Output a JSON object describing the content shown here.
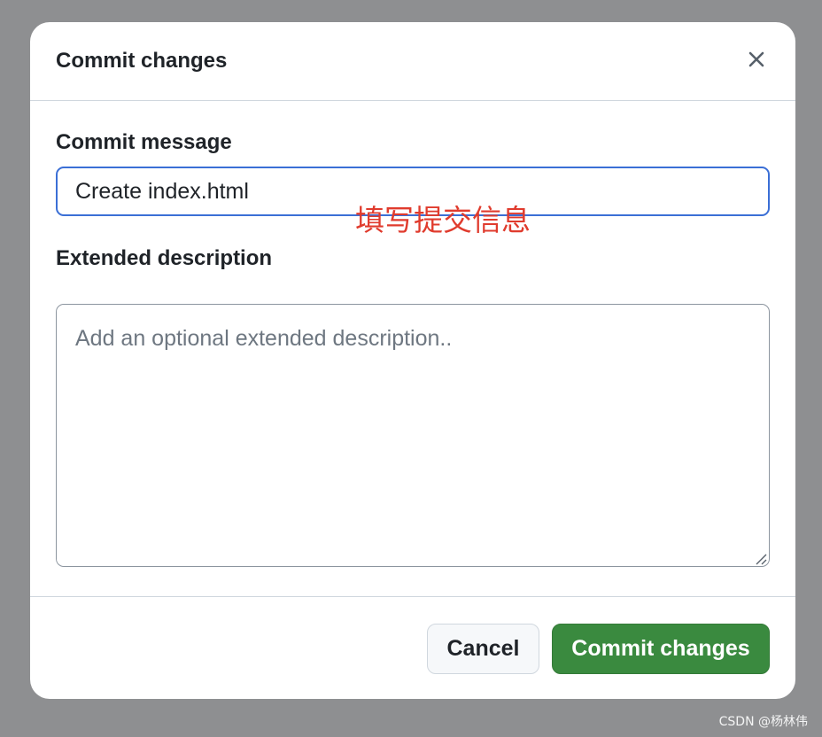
{
  "dialog": {
    "title": "Commit changes",
    "close_icon": "close-icon"
  },
  "commit_message": {
    "label": "Commit message",
    "value": "Create index.html",
    "annotation": "填写提交信息"
  },
  "extended_description": {
    "label": "Extended description",
    "placeholder": "Add an optional extended description..",
    "value": ""
  },
  "footer": {
    "cancel_label": "Cancel",
    "commit_label": "Commit changes"
  },
  "watermark": "CSDN @杨林伟",
  "colors": {
    "primary_button": "#3a8a3f",
    "focus_border": "#3b6fd6",
    "annotation": "#e03b2d"
  }
}
